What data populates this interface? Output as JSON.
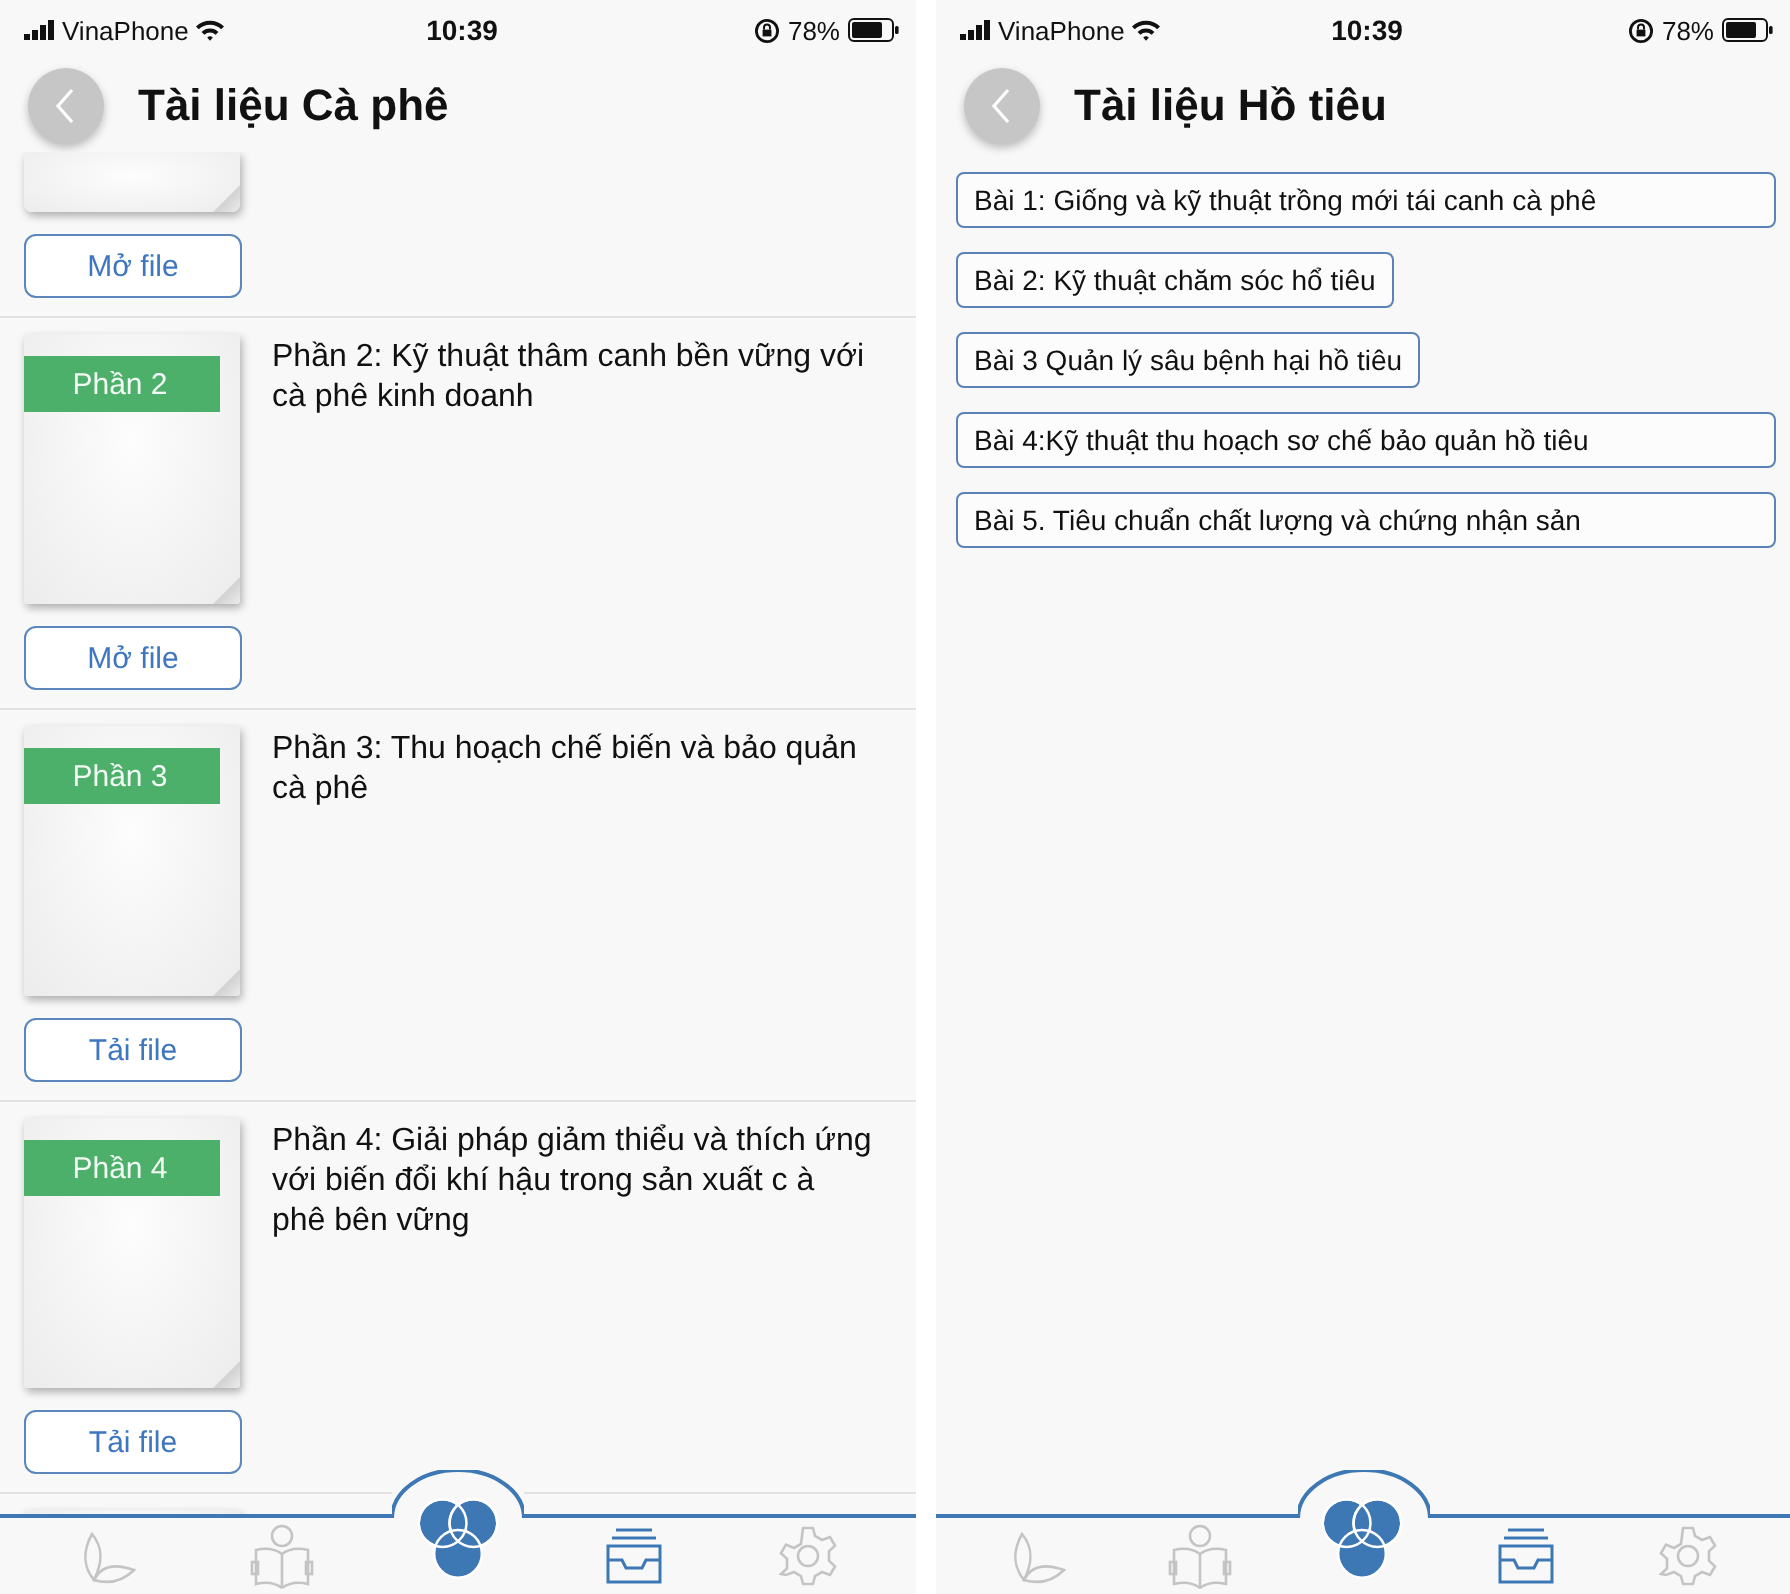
{
  "screens": [
    {
      "status": {
        "carrier": "VinaPhone",
        "time": "10:39",
        "battery": "78%"
      },
      "title": "Tài liệu Cà phê",
      "documents": [
        {
          "kind": "partial",
          "button": "Mở file"
        },
        {
          "kind": "full",
          "badge": "Phần 2",
          "title": "Phần 2: Kỹ thuật thâm canh bền vững với cà phê kinh doanh",
          "button": "Mở file"
        },
        {
          "kind": "full",
          "badge": "Phần 3",
          "title": "Phần 3: Thu hoạch chế biến và bảo quản cà phê",
          "button": "Tải file"
        },
        {
          "kind": "full",
          "badge": "Phần 4",
          "title": "Phần 4: Giải pháp giảm thiểu và thích ứng với biến đổi khí hậu trong sản xuất c à phê bên vững",
          "button": "Tải file"
        },
        {
          "kind": "peek"
        }
      ],
      "tabs": [
        {
          "kind": "leaf",
          "selected": false
        },
        {
          "kind": "reader",
          "selected": false
        },
        {
          "kind": "logo"
        },
        {
          "kind": "inbox",
          "selected": true
        },
        {
          "kind": "gear",
          "selected": false
        }
      ]
    },
    {
      "status": {
        "carrier": "VinaPhone",
        "time": "10:39",
        "battery": "78%"
      },
      "title": "Tài liệu Hồ tiêu",
      "lessons": [
        "Bài 1: Giống và kỹ thuật trồng mới tái canh cà phê",
        "Bài 2: Kỹ thuật chăm sóc hổ tiêu",
        "Bài 3 Quản lý sâu bệnh hại hồ tiêu",
        "Bài 4:Kỹ thuật thu hoạch sơ chế bảo quản hồ tiêu",
        "Bài 5. Tiêu chuẩn chất lượng và chứng nhận sản"
      ],
      "tabs": [
        {
          "kind": "leaf",
          "selected": false
        },
        {
          "kind": "reader",
          "selected": false
        },
        {
          "kind": "logo"
        },
        {
          "kind": "inbox",
          "selected": true
        },
        {
          "kind": "gear",
          "selected": false
        }
      ]
    }
  ]
}
